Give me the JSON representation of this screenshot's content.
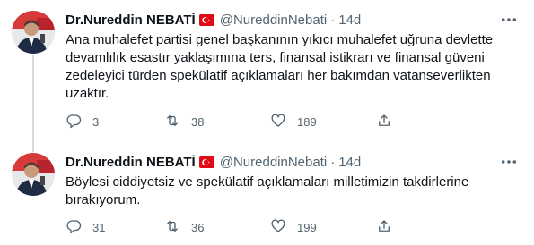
{
  "tweets": [
    {
      "display_name": "Dr.Nureddin NEBATİ",
      "handle": "@NureddinNebati",
      "separator": "·",
      "time": "14d",
      "text": "Ana muhalefet partisi genel başkanının yıkıcı muhalefet uğruna devlette\ndevamlılık esastır yaklaşımına ters, finansal istikrarı ve finansal güveni\nzedeleyici türden spekülatif açıklamaları her bakımdan vatanseverlikten\nuzaktır.",
      "replies": "3",
      "retweets": "38",
      "likes": "189"
    },
    {
      "display_name": "Dr.Nureddin NEBATİ",
      "handle": "@NureddinNebati",
      "separator": "·",
      "time": "14d",
      "text": "Böylesi ciddiyetsiz ve spekülatif açıklamaları milletimizin takdirlerine\nbırakıyorum.",
      "replies": "31",
      "retweets": "36",
      "likes": "199"
    }
  ],
  "colors": {
    "text": "#0f1419",
    "secondary": "#536471",
    "thread_line": "#cfd9de",
    "flag_red": "#e30a17"
  },
  "icons": [
    "flag-turkey-icon",
    "more-icon",
    "reply-icon",
    "retweet-icon",
    "like-icon",
    "share-icon"
  ]
}
